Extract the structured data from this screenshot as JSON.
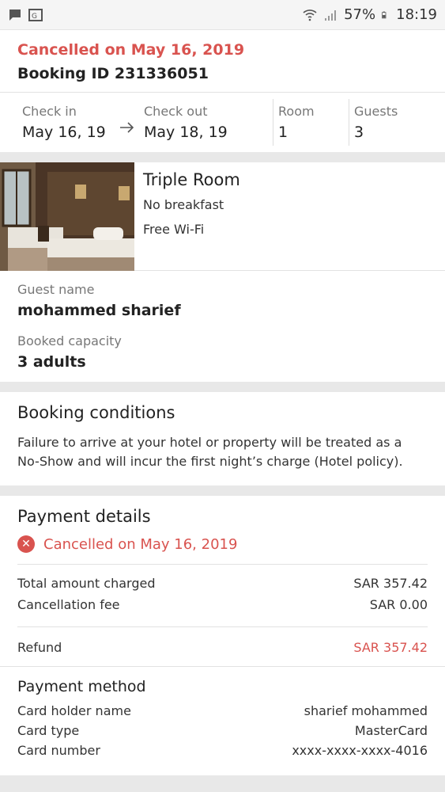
{
  "statusbar": {
    "battery": "57%",
    "time": "18:19"
  },
  "booking": {
    "cancel_title": "Cancelled on May 16, 2019",
    "booking_id": "Booking ID 231336051"
  },
  "stay": {
    "checkin_label": "Check in",
    "checkin_value": "May 16, 19",
    "checkout_label": "Check out",
    "checkout_value": "May 18, 19",
    "room_label": "Room",
    "room_value": "1",
    "guests_label": "Guests",
    "guests_value": "3"
  },
  "room": {
    "title": "Triple Room",
    "features": [
      "No breakfast",
      "Free Wi-Fi"
    ]
  },
  "guest": {
    "name_label": "Guest name",
    "name_value": "mohammed sharief",
    "capacity_label": "Booked capacity",
    "capacity_value": "3 adults"
  },
  "conditions": {
    "title": "Booking conditions",
    "text": "Failure to arrive at your hotel or property will be treated as a No-Show and will incur the first night’s charge (Hotel policy)."
  },
  "payment": {
    "title": "Payment details",
    "status": "Cancelled on May 16, 2019",
    "total_label": "Total amount charged",
    "total_value": "SAR 357.42",
    "fee_label": "Cancellation fee",
    "fee_value": "SAR 0.00",
    "refund_label": "Refund",
    "refund_value": "SAR 357.42"
  },
  "payment_method": {
    "title": "Payment method",
    "holder_label": "Card holder name",
    "holder_value": "sharief mohammed",
    "type_label": "Card type",
    "type_value": "MasterCard",
    "number_label": "Card number",
    "number_value": "xxxx-xxxx-xxxx-4016"
  },
  "colors": {
    "accent_red": "#d9534f"
  }
}
